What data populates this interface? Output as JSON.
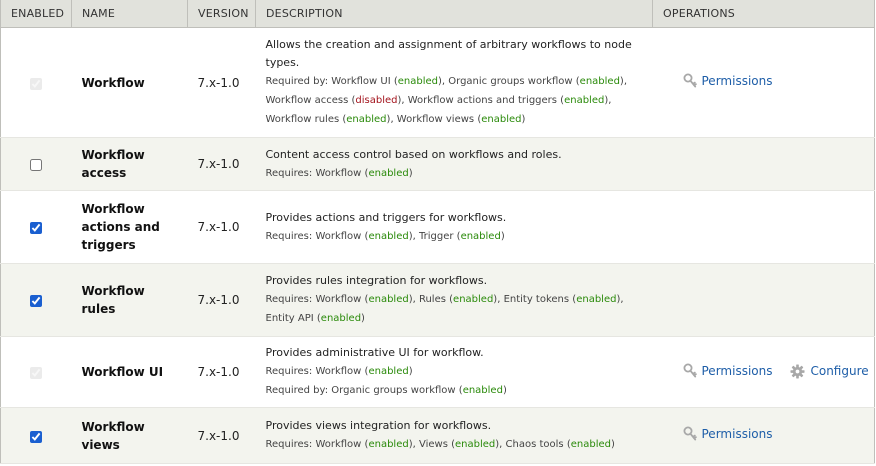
{
  "headers": {
    "enabled": "Enabled",
    "name": "Name",
    "version": "Version",
    "description": "Description",
    "operations": "Operations"
  },
  "modules": [
    {
      "name": "Workflow",
      "version": "7.x-1.0",
      "checked": true,
      "locked": true,
      "description": "Allows the creation and assignment of arbitrary workflows to node types.",
      "requires": null,
      "required_by": {
        "label": "Required by:",
        "items": [
          {
            "name": "Workflow UI",
            "status": "enabled"
          },
          {
            "name": "Organic groups workflow",
            "status": "enabled"
          },
          {
            "name": "Workflow access",
            "status": "disabled"
          },
          {
            "name": "Workflow actions and triggers",
            "status": "enabled"
          },
          {
            "name": "Workflow rules",
            "status": "enabled"
          },
          {
            "name": "Workflow views",
            "status": "enabled"
          }
        ]
      },
      "operations": [
        {
          "type": "permissions",
          "label": "Permissions"
        }
      ]
    },
    {
      "name": "Workflow access",
      "version": "7.x-1.0",
      "checked": false,
      "locked": false,
      "description": "Content access control based on workflows and roles.",
      "requires": {
        "label": "Requires:",
        "items": [
          {
            "name": "Workflow",
            "status": "enabled"
          }
        ]
      },
      "required_by": null,
      "operations": []
    },
    {
      "name": "Workflow actions and triggers",
      "version": "7.x-1.0",
      "checked": true,
      "locked": false,
      "description": "Provides actions and triggers for workflows.",
      "requires": {
        "label": "Requires:",
        "items": [
          {
            "name": "Workflow",
            "status": "enabled"
          },
          {
            "name": "Trigger",
            "status": "enabled"
          }
        ]
      },
      "required_by": null,
      "operations": []
    },
    {
      "name": "Workflow rules",
      "version": "7.x-1.0",
      "checked": true,
      "locked": false,
      "description": "Provides rules integration for workflows.",
      "requires": {
        "label": "Requires:",
        "items": [
          {
            "name": "Workflow",
            "status": "enabled"
          },
          {
            "name": "Rules",
            "status": "enabled"
          },
          {
            "name": "Entity tokens",
            "status": "enabled"
          },
          {
            "name": "Entity API",
            "status": "enabled"
          }
        ]
      },
      "required_by": null,
      "operations": []
    },
    {
      "name": "Workflow UI",
      "version": "7.x-1.0",
      "checked": true,
      "locked": true,
      "description": "Provides administrative UI for workflow.",
      "requires": {
        "label": "Requires:",
        "items": [
          {
            "name": "Workflow",
            "status": "enabled"
          }
        ]
      },
      "required_by": {
        "label": "Required by:",
        "items": [
          {
            "name": "Organic groups workflow",
            "status": "enabled"
          }
        ]
      },
      "operations": [
        {
          "type": "permissions",
          "label": "Permissions"
        },
        {
          "type": "configure",
          "label": "Configure"
        }
      ]
    },
    {
      "name": "Workflow views",
      "version": "7.x-1.0",
      "checked": true,
      "locked": false,
      "description": "Provides views integration for workflows.",
      "requires": {
        "label": "Requires:",
        "items": [
          {
            "name": "Workflow",
            "status": "enabled"
          },
          {
            "name": "Views",
            "status": "enabled"
          },
          {
            "name": "Chaos tools",
            "status": "enabled"
          }
        ]
      },
      "required_by": null,
      "operations": [
        {
          "type": "permissions",
          "label": "Permissions"
        }
      ]
    }
  ],
  "colors": {
    "enabled": "#2a8a0a",
    "disabled": "#a3141d",
    "link": "#1e5ea8",
    "header_bg": "#e1e2dc",
    "row_alt_bg": "#f3f4ee"
  }
}
